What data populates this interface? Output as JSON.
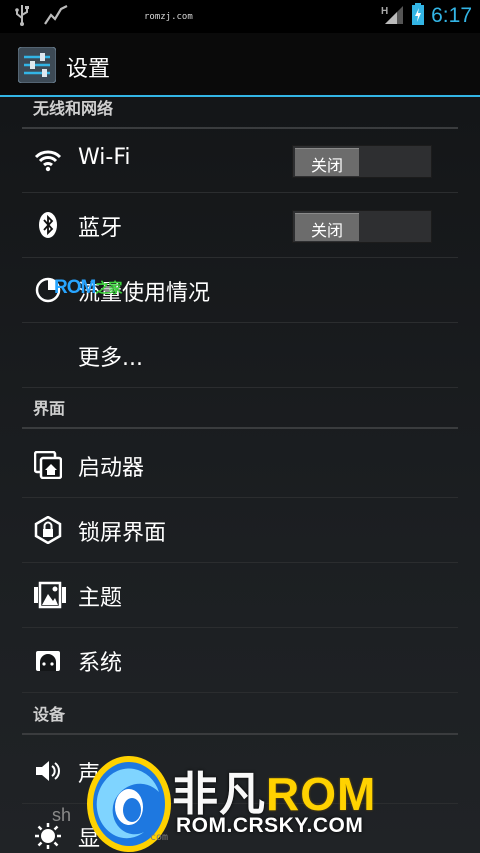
{
  "statusbar": {
    "center_text": "romzj.com",
    "time": "6:17",
    "network_type": "H",
    "icons": [
      "usb-icon",
      "activity-graph-icon",
      "signal-icon",
      "battery-charging-icon"
    ]
  },
  "actionbar": {
    "title": "设置",
    "icon": "settings-sliders-icon"
  },
  "sections": [
    {
      "header": "无线和网络",
      "items": [
        {
          "label": "Wi-Fi",
          "icon": "wifi-icon",
          "toggle": "关闭"
        },
        {
          "label": "蓝牙",
          "icon": "bluetooth-icon",
          "toggle": "关闭"
        },
        {
          "label": "流量使用情况",
          "icon": "data-usage-icon"
        },
        {
          "label": "更多..."
        }
      ]
    },
    {
      "header": "界面",
      "items": [
        {
          "label": "启动器",
          "icon": "launcher-icon"
        },
        {
          "label": "锁屏界面",
          "icon": "lock-icon"
        },
        {
          "label": "主题",
          "icon": "theme-icon"
        },
        {
          "label": "系统",
          "icon": "system-icon"
        }
      ]
    },
    {
      "header": "设备",
      "items": [
        {
          "label": "声",
          "icon": "sound-icon"
        },
        {
          "label": "显",
          "icon": "display-icon"
        }
      ]
    }
  ],
  "watermarks": {
    "small_rom": "ROM",
    "small_suffix": "之家",
    "logo_fan": "非凡",
    "logo_rom": "ROM",
    "logo_url": "ROM.CRSKY.COM",
    "sh_text": "sh",
    "tiny_url": "com"
  },
  "colors": {
    "accent": "#33b5e5",
    "logo_yellow": "#ffd200",
    "logo_blue": "#1e78e0"
  }
}
